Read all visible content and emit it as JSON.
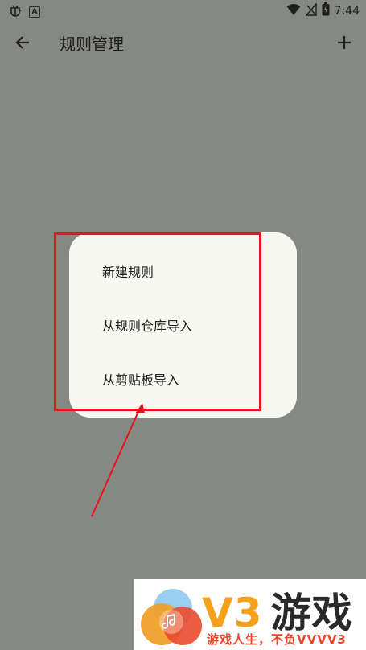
{
  "status_bar": {
    "app_icon": "bug-icon",
    "notification_icon": "A",
    "time": "7:44"
  },
  "app_bar": {
    "title": "规则管理",
    "back_icon": "arrow-left-icon",
    "add_icon": "plus-icon"
  },
  "menu": {
    "items": [
      {
        "label": "新建规则"
      },
      {
        "label": "从规则仓库导入"
      },
      {
        "label": "从剪贴板导入"
      }
    ]
  },
  "annotation": {
    "box_color": "#e8141c",
    "arrow_color": "#e8141c"
  },
  "watermark": {
    "brand_v3": "V3",
    "brand_games": "游戏",
    "slogan": "游戏人生，不负VVVV3"
  }
}
